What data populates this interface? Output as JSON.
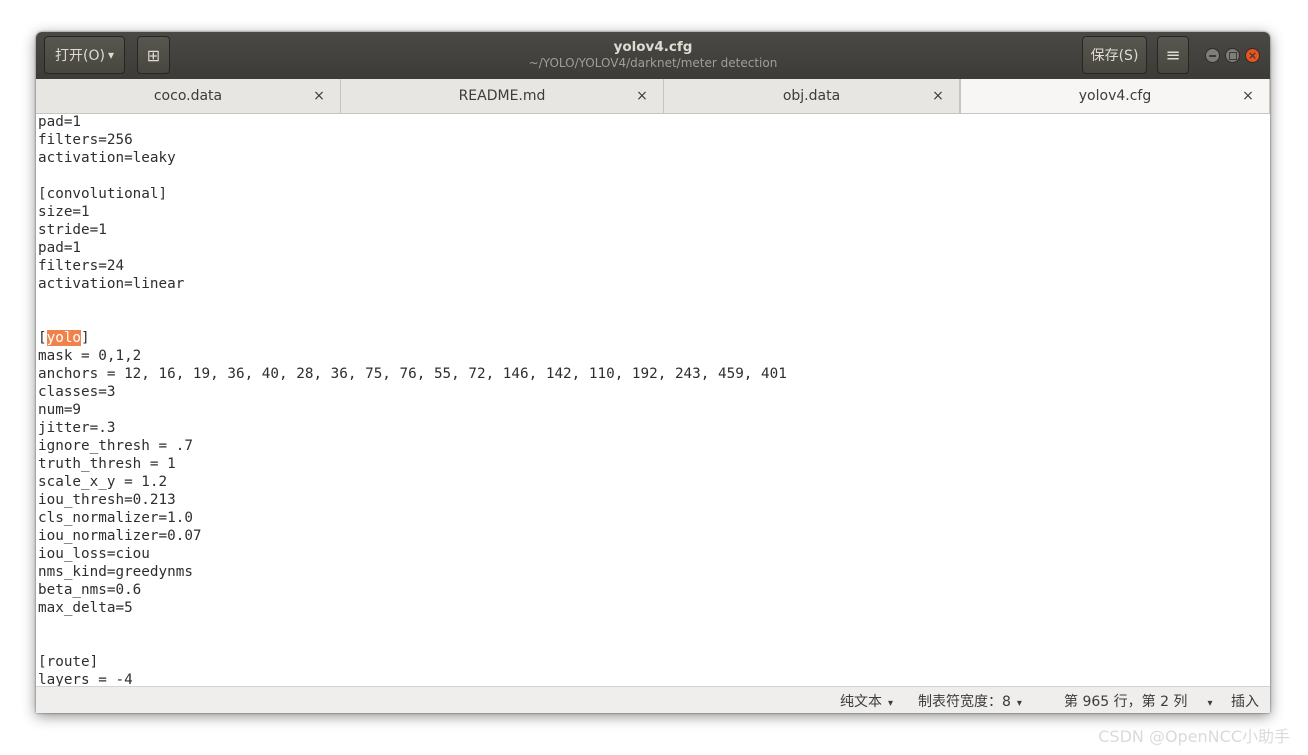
{
  "window": {
    "title": "yolov4.cfg",
    "subtitle": "~/YOLO/YOLOV4/darknet/meter detection",
    "open_label": "打开(O)",
    "open_caret": "▾",
    "save_label": "保存(S)",
    "menu_glyph": "≡",
    "pin_glyph": "⊞"
  },
  "tabs": [
    {
      "label": "coco.data",
      "close": "×"
    },
    {
      "label": "README.md",
      "close": "×"
    },
    {
      "label": "obj.data",
      "close": "×"
    },
    {
      "label": "yolov4.cfg",
      "close": "×",
      "active": true
    }
  ],
  "editor": {
    "lines": [
      "pad=1",
      "filters=256",
      "activation=leaky",
      "",
      "[convolutional]",
      "size=1",
      "stride=1",
      "pad=1",
      "filters=24",
      "activation=linear",
      "",
      "",
      "[yolo]",
      "mask = 0,1,2",
      "anchors = 12, 16, 19, 36, 40, 28, 36, 75, 76, 55, 72, 146, 142, 110, 192, 243, 459, 401",
      "classes=3",
      "num=9",
      "jitter=.3",
      "ignore_thresh = .7",
      "truth_thresh = 1",
      "scale_x_y = 1.2",
      "iou_thresh=0.213",
      "cls_normalizer=1.0",
      "iou_normalizer=0.07",
      "iou_loss=ciou",
      "nms_kind=greedynms",
      "beta_nms=0.6",
      "max_delta=5",
      "",
      "",
      "[route]",
      "layers = -4"
    ],
    "highlight": {
      "line": 12,
      "before": "[",
      "word": "yolo",
      "after": "]"
    }
  },
  "status": {
    "language": "纯文本",
    "tab_width": "制表符宽度：8",
    "position": "第 965 行，第 2 列",
    "mode": "插入",
    "caret": "▾"
  },
  "watermark": "CSDN @OpenNCC小助手",
  "colors": {
    "headerbar": "#3c3b37",
    "highlight": "#f0834a",
    "close_button": "#e95420"
  }
}
